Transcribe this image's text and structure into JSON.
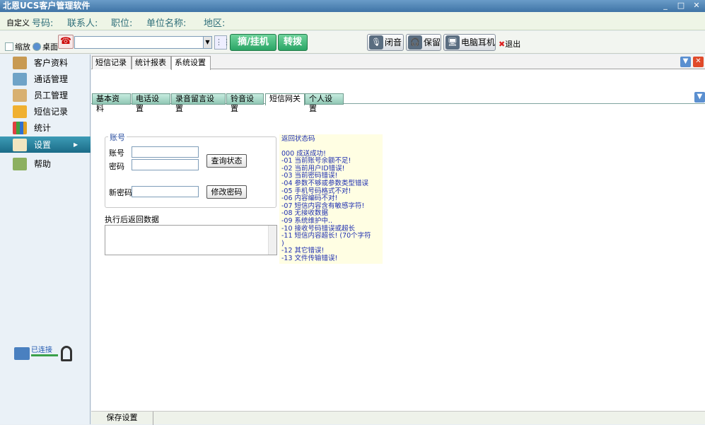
{
  "app": {
    "title": "北恩UCS客户管理软件"
  },
  "window_controls": {
    "minimize": "_",
    "maximize": "□",
    "close": "✕"
  },
  "infobar": {
    "custom_label": "自定义",
    "phone_label": "号码:",
    "contact_label": "联系人:",
    "position_label": "职位:",
    "company_label": "单位名称:",
    "region_label": "地区:"
  },
  "toolbar": {
    "shrink_label": "缩放",
    "desktop_label": "桌面",
    "phone_input_value": "",
    "hangup_label": "摘/挂机",
    "transfer_label": "转拨",
    "mute_label": "闭音",
    "hold_label": "保留",
    "pc_headset_label": "电脑耳机",
    "exit_label": "退出"
  },
  "sidebar": {
    "items": [
      {
        "label": "客户资料",
        "icon": "address-book-icon"
      },
      {
        "label": "通话管理",
        "icon": "call-icon"
      },
      {
        "label": "员工管理",
        "icon": "staff-icon"
      },
      {
        "label": "短信记录",
        "icon": "envelope-icon"
      },
      {
        "label": "统计",
        "icon": "bar-chart-icon"
      },
      {
        "label": "设置",
        "icon": "settings-icon"
      },
      {
        "label": "帮助",
        "icon": "help-icon"
      }
    ],
    "active_index": 5,
    "connection_status": "已连接"
  },
  "main": {
    "top_tabs": [
      "短信记录",
      "统计报表",
      "系统设置"
    ],
    "top_tab_selected": 2,
    "sub_tabs": [
      "基本资料",
      "电话设置",
      "录音留言设置",
      "铃音设置",
      "短信网关",
      "个人设置"
    ],
    "sub_tab_selected": 4,
    "form": {
      "group_title": "账号",
      "account_label": "账号",
      "account_value": "",
      "password_label": "密码",
      "password_value": "",
      "query_button": "查询状态",
      "new_password_label": "新密码",
      "new_password_value": "",
      "change_password_button": "修改密码",
      "result_label": "执行后返回数据",
      "result_value": ""
    },
    "status_codes": {
      "title": "返回状态码",
      "lines": [
        "000 成送成功!",
        "-01 当前账号余额不足!",
        "-02 当前用户ID错误!",
        "-03 当前密码错误!",
        "-04 参数不够或参数类型错误",
        "-05 手机号码格式不对!",
        "-06 内容编码不对!",
        "-07 短信内容含有敏感字符!",
        "-08 无接收数据",
        "-09 系统维护中..",
        "-10 接收号码错误或超长",
        "-11 短信内容超长! (70个字符",
        ")",
        "-12 其它错误!",
        "-13 文件传输错误!"
      ]
    },
    "save_button": "保存设置"
  },
  "colors": {
    "title_bar": "#3f74a6",
    "accent_green": "#2aa565",
    "sidebar_active": "#1b6c88",
    "codes_bg": "#fffee3",
    "codes_text": "#1f2fb0"
  }
}
